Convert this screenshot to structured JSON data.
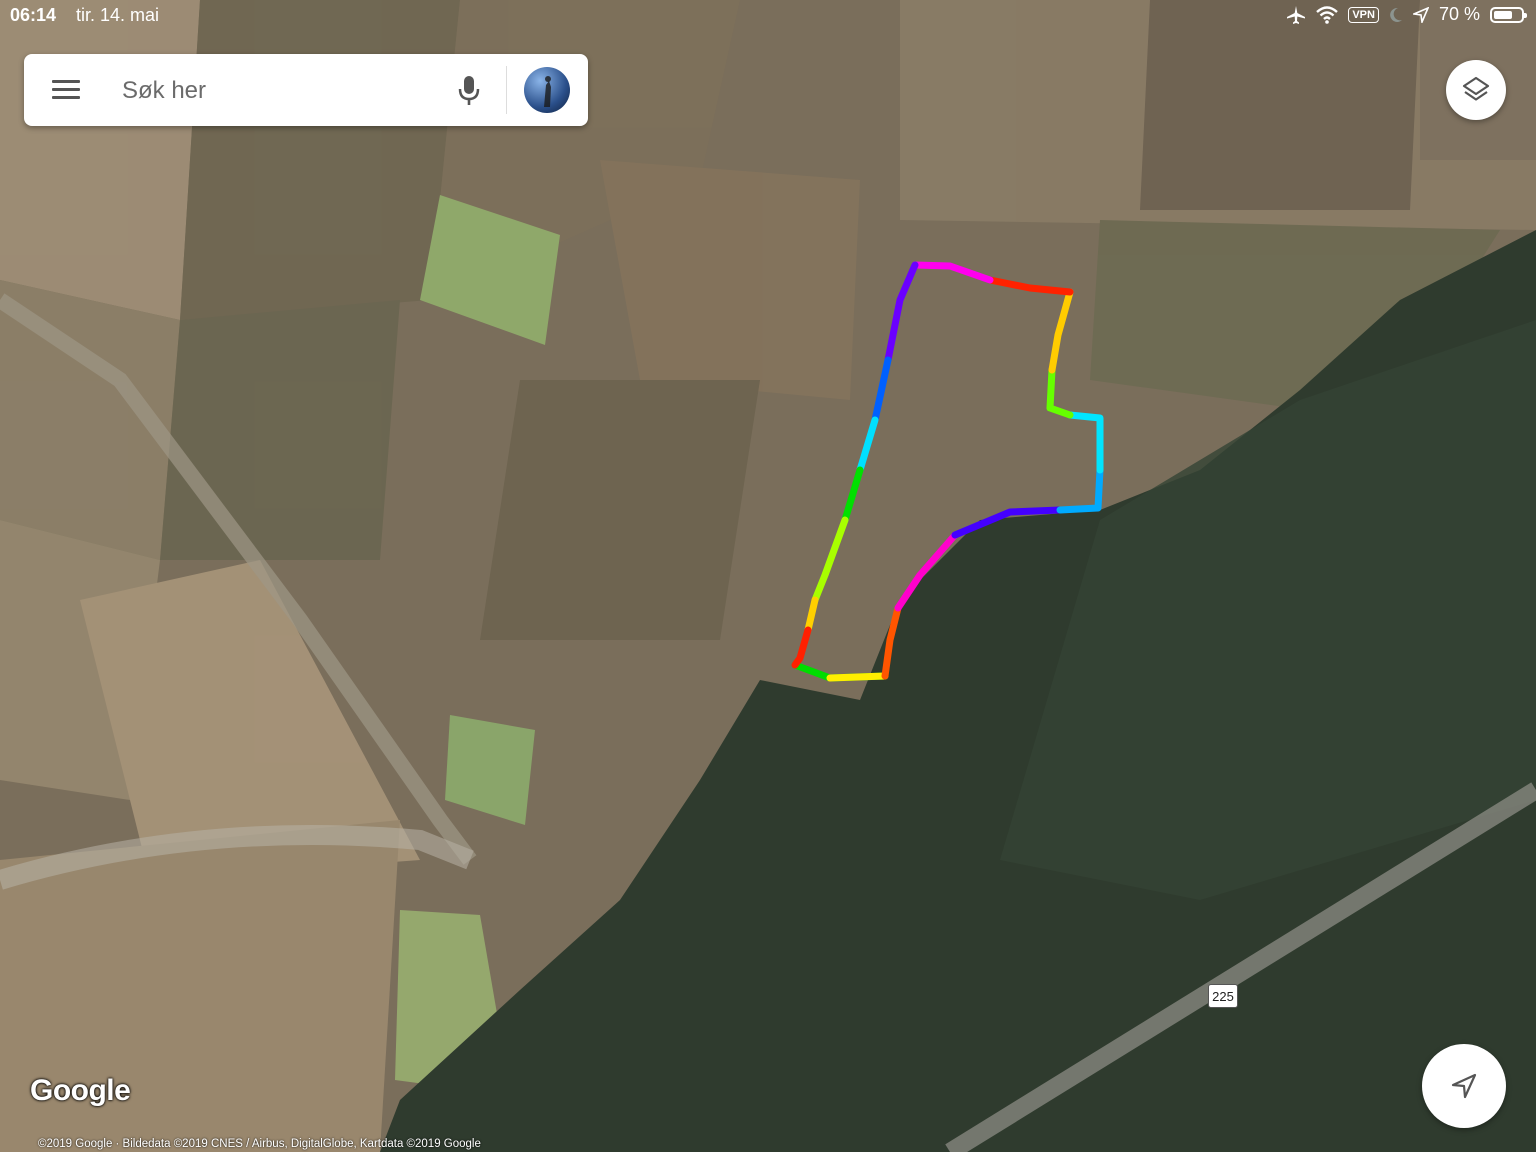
{
  "status_bar": {
    "time": "06:14",
    "date": "tir. 14. mai",
    "vpn_label": "VPN",
    "battery_text": "70 %",
    "battery_level": 0.7,
    "icons": [
      "airplane-icon",
      "wifi-icon",
      "vpn-icon",
      "moon-icon",
      "location-arrow-icon",
      "battery-icon"
    ]
  },
  "search": {
    "placeholder": "Søk her",
    "value": "",
    "menu_icon": "hamburger-menu-icon",
    "mic_icon": "microphone-icon"
  },
  "map": {
    "type": "satellite",
    "road_shield": "225",
    "logo": "Google",
    "attribution": "©2019 Google · Bildedata ©2019 CNES / Airbus, DigitalGlobe, Kartdata ©2019 Google",
    "track_colors": [
      "#ff0000",
      "#ff8800",
      "#ffee00",
      "#00dd00",
      "#00e5ff",
      "#0044ff",
      "#8800ff",
      "#ff00cc"
    ]
  },
  "controls": {
    "layers_icon": "layers-icon",
    "locate_icon": "navigation-arrow-icon"
  }
}
